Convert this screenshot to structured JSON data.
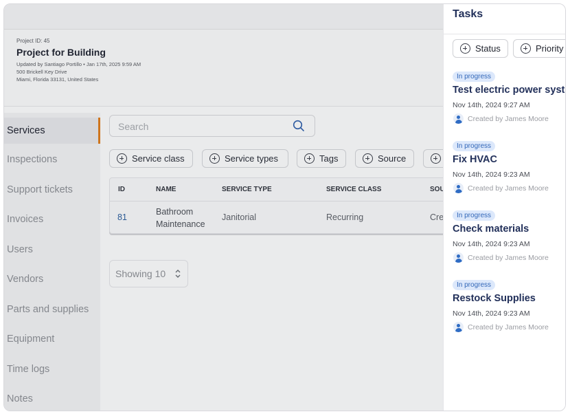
{
  "project": {
    "id_label": "Project ID: 45",
    "title": "Project for Building",
    "updated": "Updated by Santiago Portillo • Jan 17th, 2025 9:59 AM",
    "address_line1": "500 Brickell Key Drive",
    "address_line2": "Miami, Florida 33131, United States"
  },
  "sidebar": {
    "items": [
      {
        "label": "Services"
      },
      {
        "label": "Inspections"
      },
      {
        "label": "Support tickets"
      },
      {
        "label": "Invoices"
      },
      {
        "label": "Users"
      },
      {
        "label": "Vendors"
      },
      {
        "label": "Parts and supplies"
      },
      {
        "label": "Equipment"
      },
      {
        "label": "Time logs"
      },
      {
        "label": "Notes"
      }
    ]
  },
  "search": {
    "placeholder": "Search"
  },
  "filters": [
    {
      "label": "Service class"
    },
    {
      "label": "Service types"
    },
    {
      "label": "Tags"
    },
    {
      "label": "Source"
    }
  ],
  "table": {
    "columns": [
      "ID",
      "NAME",
      "SERVICE TYPE",
      "SERVICE CLASS",
      "SOU"
    ],
    "rows": [
      {
        "id": "81",
        "name_line1": "Bathroom",
        "name_line2": "Maintenance",
        "service_type": "Janitorial",
        "service_class": "Recurring",
        "source": "Cre"
      }
    ]
  },
  "pagination": {
    "showing": "Showing 10"
  },
  "tasks_panel": {
    "title": "Tasks",
    "filters": [
      {
        "label": "Status"
      },
      {
        "label": "Priority"
      }
    ],
    "tasks": [
      {
        "status": "In progress",
        "title": "Test electric power system",
        "date": "Nov 14th, 2024 9:27 AM",
        "creator": "Created by James Moore"
      },
      {
        "status": "In progress",
        "title": "Fix HVAC",
        "date": "Nov 14th, 2024 9:23 AM",
        "creator": "Created by James Moore"
      },
      {
        "status": "In progress",
        "title": "Check materials",
        "date": "Nov 14th, 2024 9:23 AM",
        "creator": "Created by James Moore"
      },
      {
        "status": "In progress",
        "title": "Restock Supplies",
        "date": "Nov 14th, 2024 9:23 AM",
        "creator": "Created by James Moore"
      }
    ]
  },
  "colors": {
    "accent": "#d97a1c",
    "link": "#2a5b9a",
    "badge_bg": "#dce8fb",
    "panel_title": "#22305a"
  }
}
